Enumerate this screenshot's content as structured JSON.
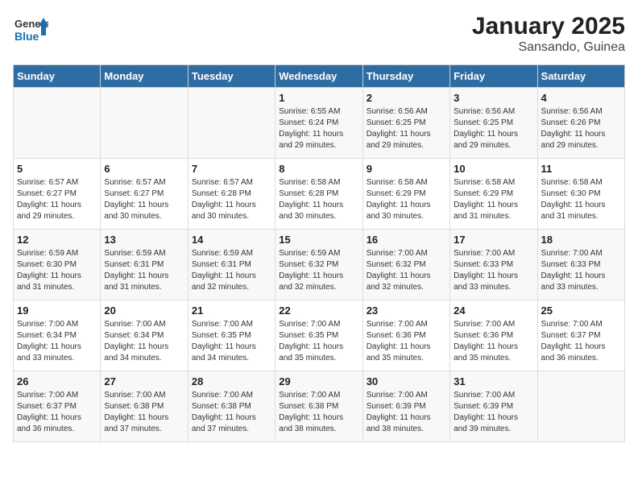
{
  "logo": {
    "general": "General",
    "blue": "Blue"
  },
  "title": "January 2025",
  "subtitle": "Sansando, Guinea",
  "headers": [
    "Sunday",
    "Monday",
    "Tuesday",
    "Wednesday",
    "Thursday",
    "Friday",
    "Saturday"
  ],
  "weeks": [
    [
      {
        "day": "",
        "info": ""
      },
      {
        "day": "",
        "info": ""
      },
      {
        "day": "",
        "info": ""
      },
      {
        "day": "1",
        "info": "Sunrise: 6:55 AM\nSunset: 6:24 PM\nDaylight: 11 hours\nand 29 minutes."
      },
      {
        "day": "2",
        "info": "Sunrise: 6:56 AM\nSunset: 6:25 PM\nDaylight: 11 hours\nand 29 minutes."
      },
      {
        "day": "3",
        "info": "Sunrise: 6:56 AM\nSunset: 6:25 PM\nDaylight: 11 hours\nand 29 minutes."
      },
      {
        "day": "4",
        "info": "Sunrise: 6:56 AM\nSunset: 6:26 PM\nDaylight: 11 hours\nand 29 minutes."
      }
    ],
    [
      {
        "day": "5",
        "info": "Sunrise: 6:57 AM\nSunset: 6:27 PM\nDaylight: 11 hours\nand 29 minutes."
      },
      {
        "day": "6",
        "info": "Sunrise: 6:57 AM\nSunset: 6:27 PM\nDaylight: 11 hours\nand 30 minutes."
      },
      {
        "day": "7",
        "info": "Sunrise: 6:57 AM\nSunset: 6:28 PM\nDaylight: 11 hours\nand 30 minutes."
      },
      {
        "day": "8",
        "info": "Sunrise: 6:58 AM\nSunset: 6:28 PM\nDaylight: 11 hours\nand 30 minutes."
      },
      {
        "day": "9",
        "info": "Sunrise: 6:58 AM\nSunset: 6:29 PM\nDaylight: 11 hours\nand 30 minutes."
      },
      {
        "day": "10",
        "info": "Sunrise: 6:58 AM\nSunset: 6:29 PM\nDaylight: 11 hours\nand 31 minutes."
      },
      {
        "day": "11",
        "info": "Sunrise: 6:58 AM\nSunset: 6:30 PM\nDaylight: 11 hours\nand 31 minutes."
      }
    ],
    [
      {
        "day": "12",
        "info": "Sunrise: 6:59 AM\nSunset: 6:30 PM\nDaylight: 11 hours\nand 31 minutes."
      },
      {
        "day": "13",
        "info": "Sunrise: 6:59 AM\nSunset: 6:31 PM\nDaylight: 11 hours\nand 31 minutes."
      },
      {
        "day": "14",
        "info": "Sunrise: 6:59 AM\nSunset: 6:31 PM\nDaylight: 11 hours\nand 32 minutes."
      },
      {
        "day": "15",
        "info": "Sunrise: 6:59 AM\nSunset: 6:32 PM\nDaylight: 11 hours\nand 32 minutes."
      },
      {
        "day": "16",
        "info": "Sunrise: 7:00 AM\nSunset: 6:32 PM\nDaylight: 11 hours\nand 32 minutes."
      },
      {
        "day": "17",
        "info": "Sunrise: 7:00 AM\nSunset: 6:33 PM\nDaylight: 11 hours\nand 33 minutes."
      },
      {
        "day": "18",
        "info": "Sunrise: 7:00 AM\nSunset: 6:33 PM\nDaylight: 11 hours\nand 33 minutes."
      }
    ],
    [
      {
        "day": "19",
        "info": "Sunrise: 7:00 AM\nSunset: 6:34 PM\nDaylight: 11 hours\nand 33 minutes."
      },
      {
        "day": "20",
        "info": "Sunrise: 7:00 AM\nSunset: 6:34 PM\nDaylight: 11 hours\nand 34 minutes."
      },
      {
        "day": "21",
        "info": "Sunrise: 7:00 AM\nSunset: 6:35 PM\nDaylight: 11 hours\nand 34 minutes."
      },
      {
        "day": "22",
        "info": "Sunrise: 7:00 AM\nSunset: 6:35 PM\nDaylight: 11 hours\nand 35 minutes."
      },
      {
        "day": "23",
        "info": "Sunrise: 7:00 AM\nSunset: 6:36 PM\nDaylight: 11 hours\nand 35 minutes."
      },
      {
        "day": "24",
        "info": "Sunrise: 7:00 AM\nSunset: 6:36 PM\nDaylight: 11 hours\nand 35 minutes."
      },
      {
        "day": "25",
        "info": "Sunrise: 7:00 AM\nSunset: 6:37 PM\nDaylight: 11 hours\nand 36 minutes."
      }
    ],
    [
      {
        "day": "26",
        "info": "Sunrise: 7:00 AM\nSunset: 6:37 PM\nDaylight: 11 hours\nand 36 minutes."
      },
      {
        "day": "27",
        "info": "Sunrise: 7:00 AM\nSunset: 6:38 PM\nDaylight: 11 hours\nand 37 minutes."
      },
      {
        "day": "28",
        "info": "Sunrise: 7:00 AM\nSunset: 6:38 PM\nDaylight: 11 hours\nand 37 minutes."
      },
      {
        "day": "29",
        "info": "Sunrise: 7:00 AM\nSunset: 6:38 PM\nDaylight: 11 hours\nand 38 minutes."
      },
      {
        "day": "30",
        "info": "Sunrise: 7:00 AM\nSunset: 6:39 PM\nDaylight: 11 hours\nand 38 minutes."
      },
      {
        "day": "31",
        "info": "Sunrise: 7:00 AM\nSunset: 6:39 PM\nDaylight: 11 hours\nand 39 minutes."
      },
      {
        "day": "",
        "info": ""
      }
    ]
  ]
}
